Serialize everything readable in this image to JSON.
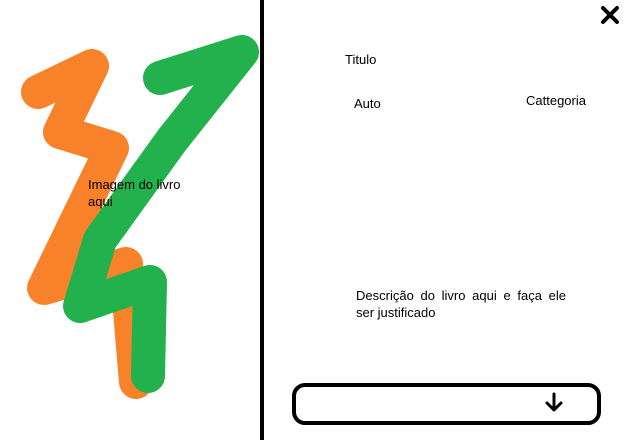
{
  "image_panel": {
    "caption": "Imagem do livro aqui",
    "colors": {
      "orange": "#f8822a",
      "green": "#22b14c"
    }
  },
  "book": {
    "title": "Titulo",
    "author": "Auto",
    "category": "Cattegoria",
    "description": "Descrição do livro aqui e faça ele ser justificado"
  },
  "icons": {
    "close": "close-icon",
    "arrow": "arrow-down-icon"
  },
  "colors": {
    "ink": "#000000",
    "background": "#ffffff"
  }
}
